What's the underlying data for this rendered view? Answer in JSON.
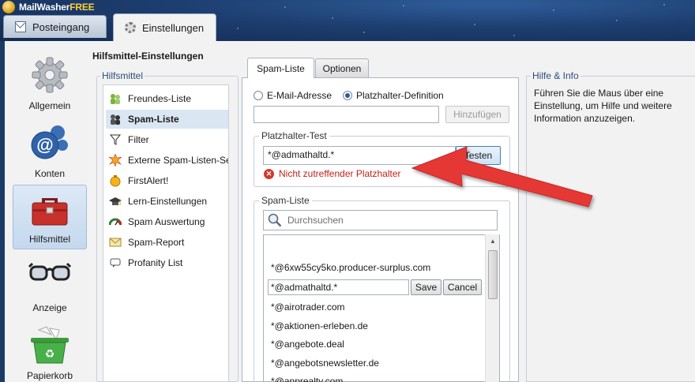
{
  "app": {
    "title_main": "MailWasher",
    "title_suffix": "FREE"
  },
  "tabs": [
    {
      "label": "Posteingang",
      "icon": "mail-icon"
    },
    {
      "label": "Einstellungen",
      "icon": "gear-icon"
    }
  ],
  "nav": {
    "items": [
      {
        "label": "Allgemein",
        "icon": "gear-icon"
      },
      {
        "label": "Konten",
        "icon": "at-sign-icon"
      },
      {
        "label": "Hilfsmittel",
        "icon": "toolbox-icon"
      },
      {
        "label": "Anzeige",
        "icon": "glasses-icon"
      },
      {
        "label": "Papierkorb",
        "icon": "recycle-bin-icon"
      }
    ],
    "selected": "Hilfsmittel"
  },
  "heading": "Hilfsmittel-Einstellungen",
  "hilfsmittel": {
    "legend": "Hilfsmittel",
    "items": [
      {
        "label": "Freundes-Liste",
        "icon": "friends-icon"
      },
      {
        "label": "Spam-Liste",
        "icon": "spam-icon"
      },
      {
        "label": "Filter",
        "icon": "filter-icon"
      },
      {
        "label": "Externe Spam-Listen-Server",
        "icon": "burst-icon"
      },
      {
        "label": "FirstAlert!",
        "icon": "alert-icon"
      },
      {
        "label": "Lern-Einstellungen",
        "icon": "graduation-cap-icon"
      },
      {
        "label": "Spam Auswertung",
        "icon": "gauge-icon"
      },
      {
        "label": "Spam-Report",
        "icon": "report-icon"
      },
      {
        "label": "Profanity List",
        "icon": "profanity-icon"
      }
    ],
    "selected": "Spam-Liste"
  },
  "center_tabs": [
    "Spam-Liste",
    "Optionen"
  ],
  "radios": {
    "email_label": "E-Mail-Adresse",
    "placeholder_label": "Platzhalter-Definition",
    "selected": "Platzhalter-Definition"
  },
  "add_input_value": "",
  "add_button": "Hinzufügen",
  "test_group": {
    "legend": "Platzhalter-Test",
    "input_value": "*@admathaltd.*",
    "button": "Testen",
    "error": "Nicht zutreffender Platzhalter"
  },
  "spam_list": {
    "legend": "Spam-Liste",
    "search_placeholder": "Durchsuchen",
    "entries_before": [
      "*@6xw55cy5ko.producer-surplus.com"
    ],
    "edit": {
      "value": "*@admathaltd.*",
      "save": "Save",
      "cancel": "Cancel"
    },
    "entries_after": [
      "*@airotrader.com",
      "*@aktionen-erleben.de",
      "*@angebote.deal",
      "*@angebotsnewsletter.de",
      "*@anprealty.com"
    ]
  },
  "info": {
    "title": "Hilfe & Info",
    "text": "Führen Sie die Maus über eine Einstellung, um Hilfe und weitere Information anzuzeigen."
  },
  "colors": {
    "accent": "#2c4d7a",
    "error": "#c0231a",
    "arrow": "#e53935",
    "selection": "#dbe6f3"
  }
}
